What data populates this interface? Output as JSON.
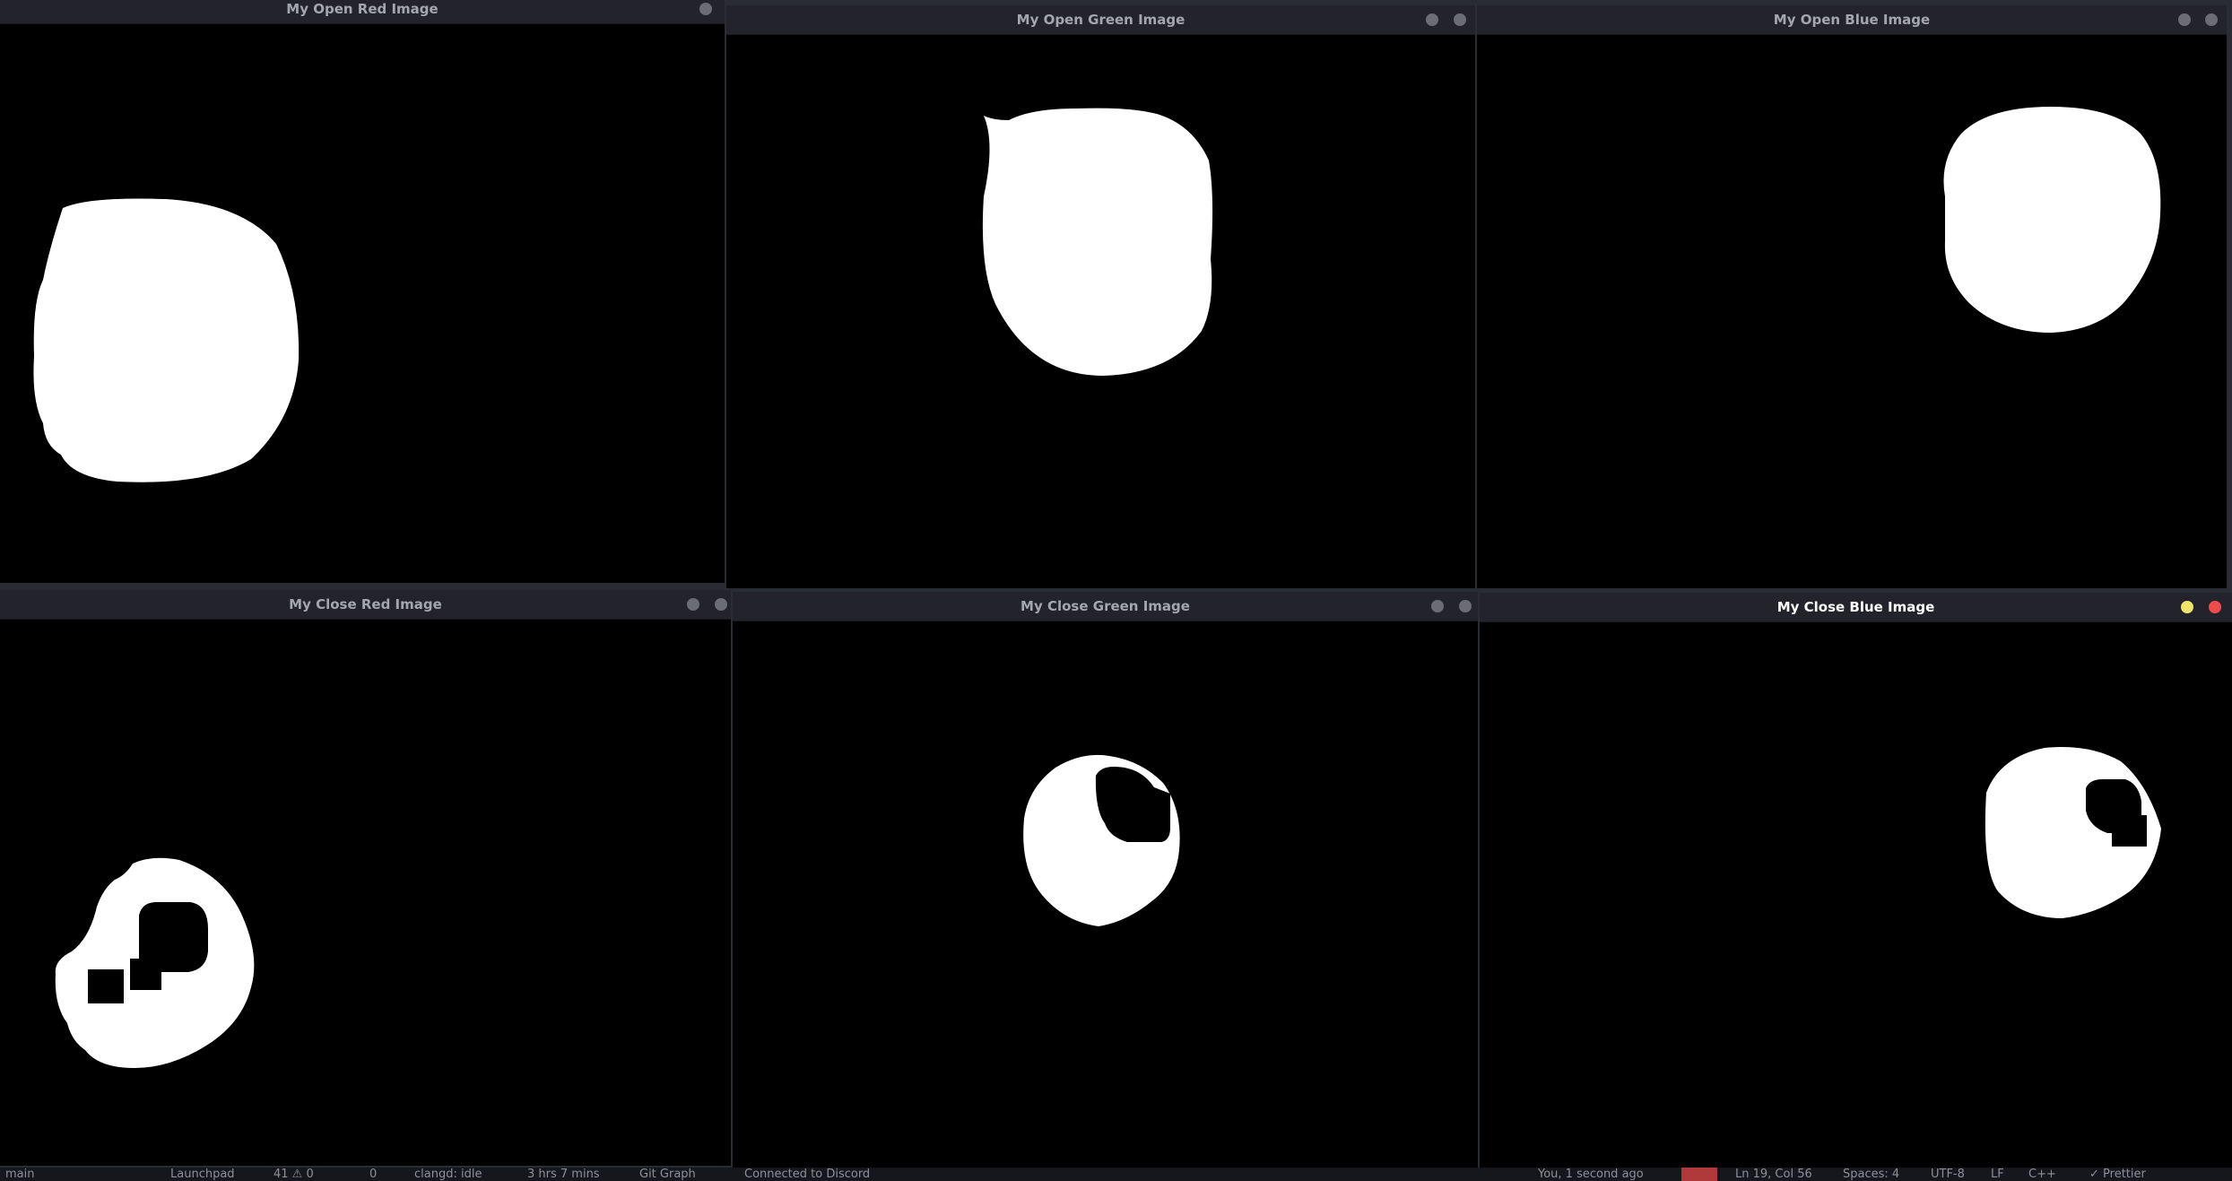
{
  "windows": {
    "open_red": {
      "title": "My Open Red Image"
    },
    "open_green": {
      "title": "My Open Green Image"
    },
    "open_blue": {
      "title": "My Open Blue Image"
    },
    "close_red": {
      "title": "My Close Red Image"
    },
    "close_green": {
      "title": "My Close Green Image"
    },
    "close_blue": {
      "title": "My Close Blue Image"
    }
  },
  "status_bar": {
    "branch": "main",
    "launchpad": "Launchpad",
    "problems": "41 ⚠ 0",
    "ports": "0",
    "clangd": "clangd: idle",
    "time": "3 hrs 7 mins",
    "git_graph": "Git Graph",
    "discord": "Connected to Discord",
    "blame": "You, 1 second ago",
    "position": "Ln 19, Col 56",
    "spaces": "Spaces: 4",
    "encoding": "UTF-8",
    "eol": "LF",
    "language": "C++",
    "prettier": "✓ Prettier"
  },
  "colors": {
    "titlebar": "#23242b",
    "inactive_button": "#6a6d76",
    "minimize_active": "#f2e36b",
    "close_active": "#ee4c4c",
    "mask_foreground": "#ffffff",
    "mask_background": "#000000"
  }
}
